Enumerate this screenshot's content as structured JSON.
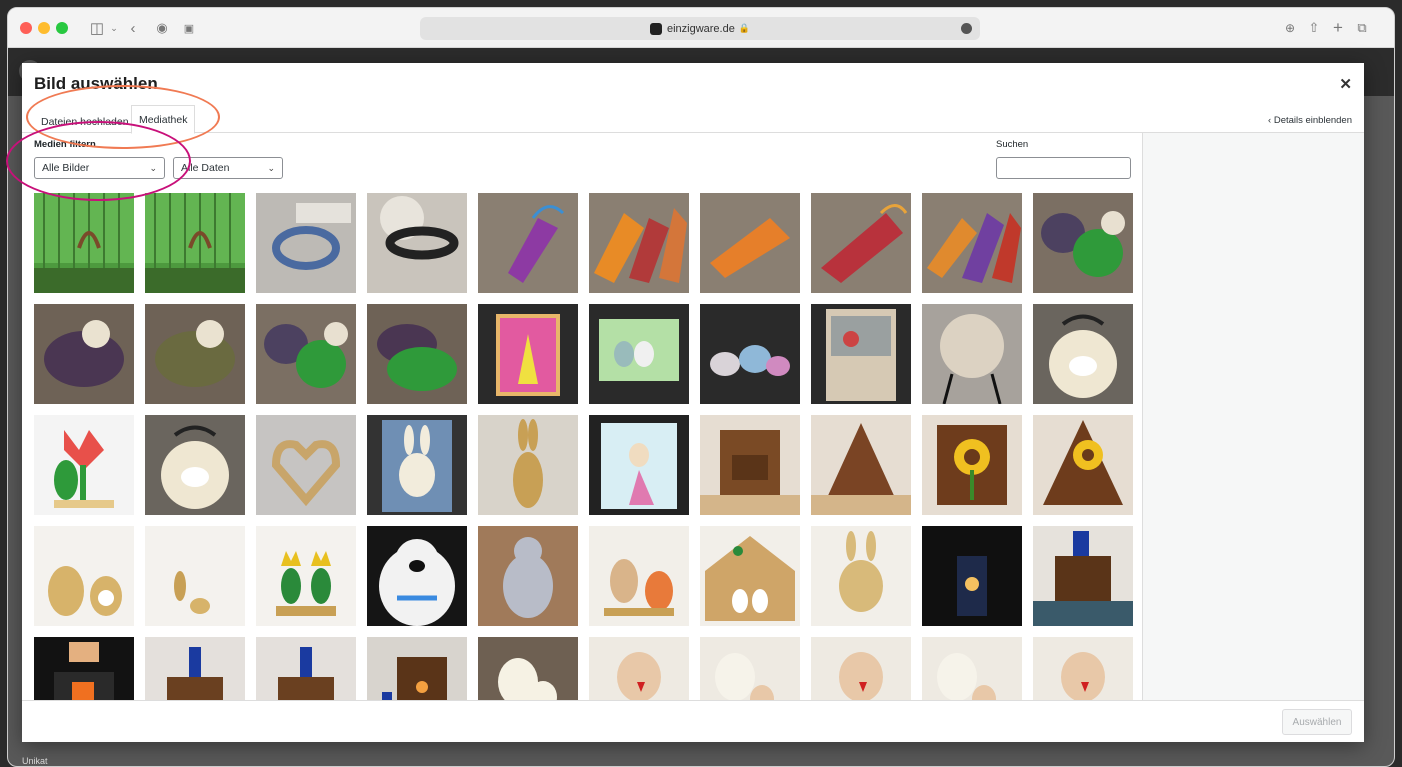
{
  "browser": {
    "url": "einzigware.de"
  },
  "background": {
    "footer_label": "Unikat"
  },
  "modal": {
    "title": "Bild auswählen",
    "tabs": [
      "Dateien hochladen",
      "Mediathek"
    ],
    "active_tab": "Mediathek",
    "details_link": "Details einblenden",
    "filter_label": "Medien filtern",
    "filter_type": "Alle Bilder",
    "filter_date": "Alle Daten",
    "search_label": "Suchen",
    "search_value": "",
    "select_button": "Auswählen"
  },
  "colors": {
    "annotation_orange": "#f07a53",
    "annotation_magenta": "#c8107a",
    "wp_blue": "#2271b1"
  },
  "thumbnails": [
    [
      "horseshoe-green",
      "horseshoe-green",
      "collar-blue",
      "collar-black",
      "purple-bag",
      "orange-shoes",
      "orange-bag",
      "red-bag",
      "mixed-shoes",
      "elephant-green"
    ],
    [
      "elephant-purple",
      "elephant-olive",
      "elephant-green",
      "elephant-pair",
      "card-pink",
      "card-green",
      "birds-fabric",
      "card-pocket",
      "round-bag",
      "sheep-bag"
    ],
    [
      "tulip-wood",
      "sheep-bag",
      "heart-wood",
      "card-bunny",
      "bunny-wood",
      "card-bunny-dress",
      "box-wood",
      "triangle-wood",
      "sunflower-box",
      "sunflower-triangle"
    ],
    [
      "bunnies-wood",
      "small-wood",
      "tulips-wood",
      "bear-white",
      "bear-grey",
      "bunny-egg",
      "easter-house",
      "bunny-face",
      "lamp-dark",
      "bottle-box"
    ],
    [
      "lantern",
      "bottle-wood",
      "bottle-wood",
      "lantern-wood",
      "chick-board",
      "chicken",
      "chicken-white",
      "chicken",
      "chicken-white",
      "chicken"
    ]
  ]
}
